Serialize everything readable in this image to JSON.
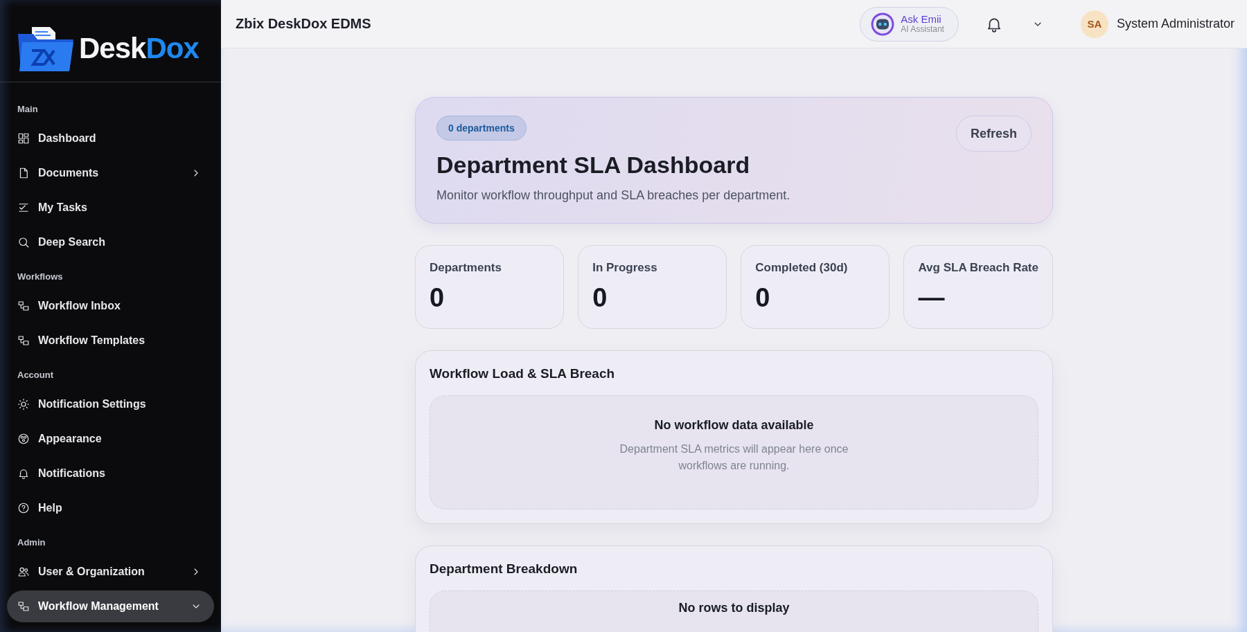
{
  "sidebar": {
    "logo": {
      "prefix": "Desk",
      "suffix": "Dox"
    },
    "sections": [
      {
        "title": "Main",
        "items": [
          {
            "label": "Dashboard",
            "kind": "link",
            "selected": false
          },
          {
            "label": "Documents",
            "kind": "group",
            "selected": false,
            "expanded": false
          },
          {
            "label": "My Tasks",
            "kind": "link",
            "selected": false
          },
          {
            "label": "Deep Search",
            "kind": "link",
            "selected": false
          }
        ]
      },
      {
        "title": "Workflows",
        "items": [
          {
            "label": "Workflow Inbox",
            "kind": "link",
            "selected": false
          },
          {
            "label": "Workflow Templates",
            "kind": "link",
            "selected": false
          }
        ]
      },
      {
        "title": "Account",
        "items": [
          {
            "label": "Notification Settings",
            "kind": "link",
            "selected": false
          },
          {
            "label": "Appearance",
            "kind": "link",
            "selected": false
          },
          {
            "label": "Notifications",
            "kind": "link",
            "selected": false
          },
          {
            "label": "Help",
            "kind": "link",
            "selected": false
          }
        ]
      },
      {
        "title": "Admin",
        "items": [
          {
            "label": "User & Organization",
            "kind": "group",
            "selected": false,
            "expanded": false
          },
          {
            "label": "Workflow Management",
            "kind": "group",
            "selected": true,
            "expanded": true
          }
        ]
      }
    ]
  },
  "header": {
    "title": "Zbix DeskDox EDMS",
    "assistant": {
      "name": "Ask Emii",
      "subtitle": "AI Assistant"
    },
    "user": {
      "initials": "SA",
      "name": "System Administrator"
    }
  },
  "hero": {
    "badge": "0 departments",
    "title": "Department SLA Dashboard",
    "subtitle": "Monitor workflow throughput and SLA breaches per department.",
    "button": "Refresh"
  },
  "stats": [
    {
      "label": "Departments",
      "value": "0"
    },
    {
      "label": "In Progress",
      "value": "0"
    },
    {
      "label": "Completed (30d)",
      "value": "0"
    },
    {
      "label": "Avg SLA Breach Rate",
      "value": "—"
    }
  ],
  "panels": [
    {
      "title": "Workflow Load & SLA Breach",
      "empty_title": "No workflow data available",
      "empty_text": "Department SLA metrics will appear here once workflows are running."
    },
    {
      "title": "Department Breakdown",
      "empty_title": "No rows to display"
    }
  ]
}
